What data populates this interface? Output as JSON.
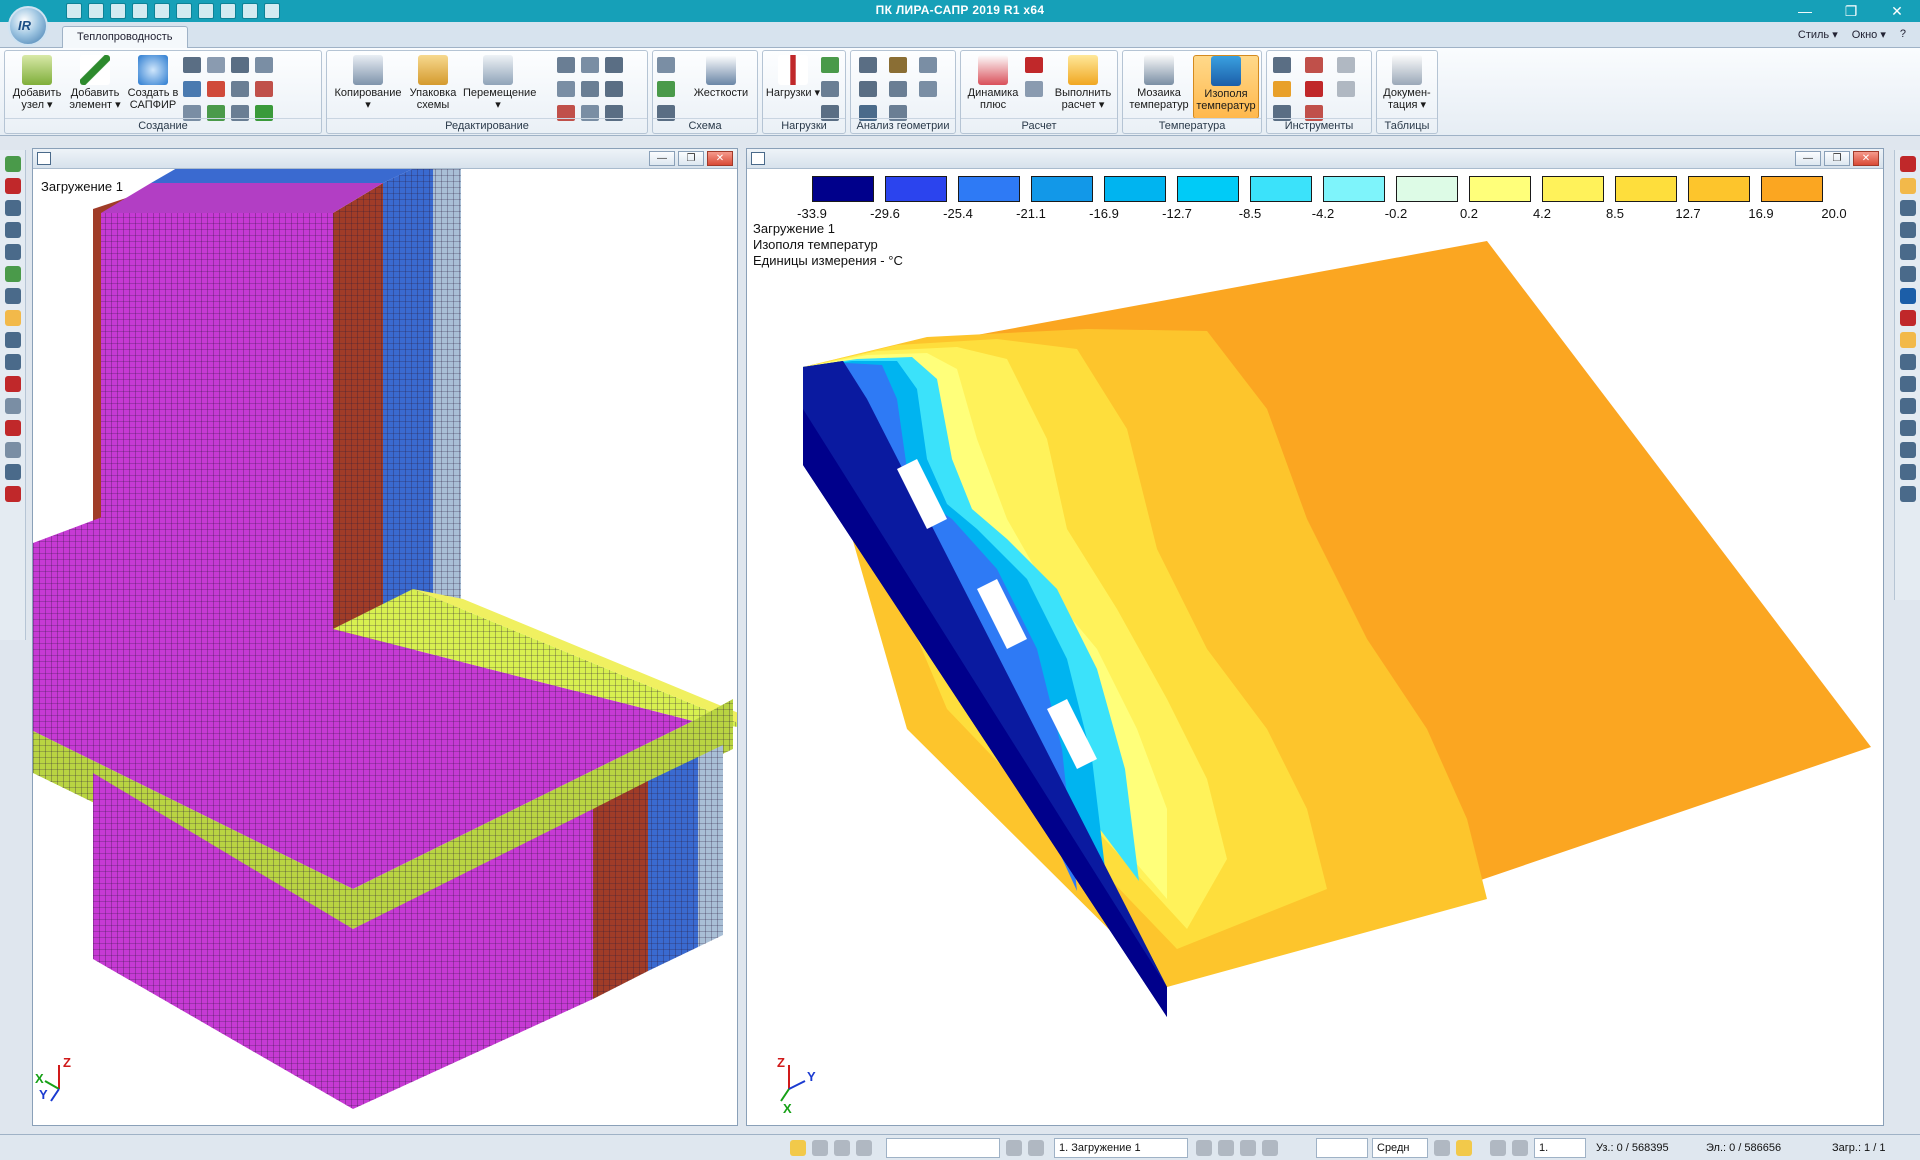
{
  "app": {
    "title": "ПК ЛИРА-САПР  2019 R1 x64",
    "logo_text": "IR"
  },
  "window_controls": {
    "minimize": "—",
    "maximize": "❐",
    "close": "✕"
  },
  "tabs": {
    "main": "Теплопроводность",
    "style": "Стиль ▾",
    "window": "Окно ▾",
    "help": "?"
  },
  "ribbon": {
    "groups": {
      "create": "Создание",
      "edit": "Редактирование",
      "scheme": "Схема",
      "loads": "Нагрузки",
      "geom": "Анализ геометрии",
      "calc": "Расчет",
      "temp": "Температура",
      "tools": "Инструменты",
      "tables": "Таблицы"
    },
    "buttons": {
      "add_node": "Добавить узел ▾",
      "add_element": "Добавить элемент ▾",
      "create_sapfir": "Создать в САПФИР",
      "copy": "Копирование ▾",
      "pack": "Упаковка схемы",
      "move": "Перемещение ▾",
      "stiffness": "Жесткости",
      "loads": "Нагрузки ▾",
      "dynamics": "Динамика плюс",
      "run_calc": "Выполнить расчет ▾",
      "temp_mosaic": "Мозаика температур",
      "temp_isofields": "Изополя температур",
      "docs": "Докумен- тация ▾"
    }
  },
  "windows": {
    "left": {
      "load_label": "Загружение 1"
    },
    "right": {
      "load_label": "Загружение 1",
      "result_label": "Изополя температур",
      "units_label": "Единицы измерения - °C"
    }
  },
  "legend": {
    "colors": [
      "#00008b",
      "#2b44ee",
      "#2e7af5",
      "#1298e8",
      "#00b4f0",
      "#00cbf7",
      "#3be2fa",
      "#7ef4fb",
      "#ddfbe6",
      "#ffff7a",
      "#fff25a",
      "#fede3c",
      "#fdc52c",
      "#fba621"
    ],
    "values": [
      "-33.9",
      "-29.6",
      "-25.4",
      "-21.1",
      "-16.9",
      "-12.7",
      "-8.5",
      "-4.2",
      "-0.2",
      "0.2",
      "4.2",
      "8.5",
      "12.7",
      "16.9",
      "20.0"
    ]
  },
  "axes": {
    "x": "X",
    "y": "Y",
    "z": "Z"
  },
  "status": {
    "load_select": "1. Загружение 1",
    "quality": "Средн",
    "scale": "1.",
    "nodes": "Уз.: 0 / 568395",
    "elements": "Эл.: 0 / 586656",
    "loadings": "Загр.: 1 / 1"
  }
}
